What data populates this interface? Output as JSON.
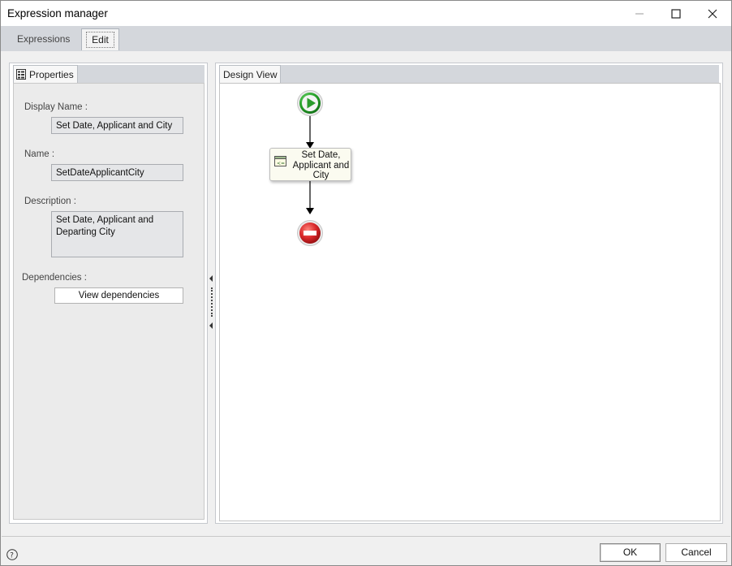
{
  "window": {
    "title": "Expression manager"
  },
  "tabs": [
    {
      "label": "Expressions"
    },
    {
      "label": "Edit"
    }
  ],
  "properties": {
    "tab_label": "Properties",
    "display_name_label": "Display Name :",
    "display_name_value": "Set Date, Applicant and City",
    "name_label": "Name :",
    "name_value": "SetDateApplicantCity",
    "description_label": "Description :",
    "description_value": "Set Date, Applicant and Departing City",
    "dependencies_label": "Dependencies :",
    "view_dependencies_button": "View dependencies"
  },
  "design": {
    "tab_label": "Design View",
    "activity_label": "Set Date, Applicant and City",
    "start_icon": "play-circle-green",
    "end_icon": "stop-circle-red"
  },
  "footer": {
    "ok_label": "OK",
    "cancel_label": "Cancel",
    "help_icon": "question-circle"
  },
  "colors": {
    "start_green": "#29a52b",
    "end_red": "#d9282a",
    "tab_strip": "#d4d7dc"
  }
}
